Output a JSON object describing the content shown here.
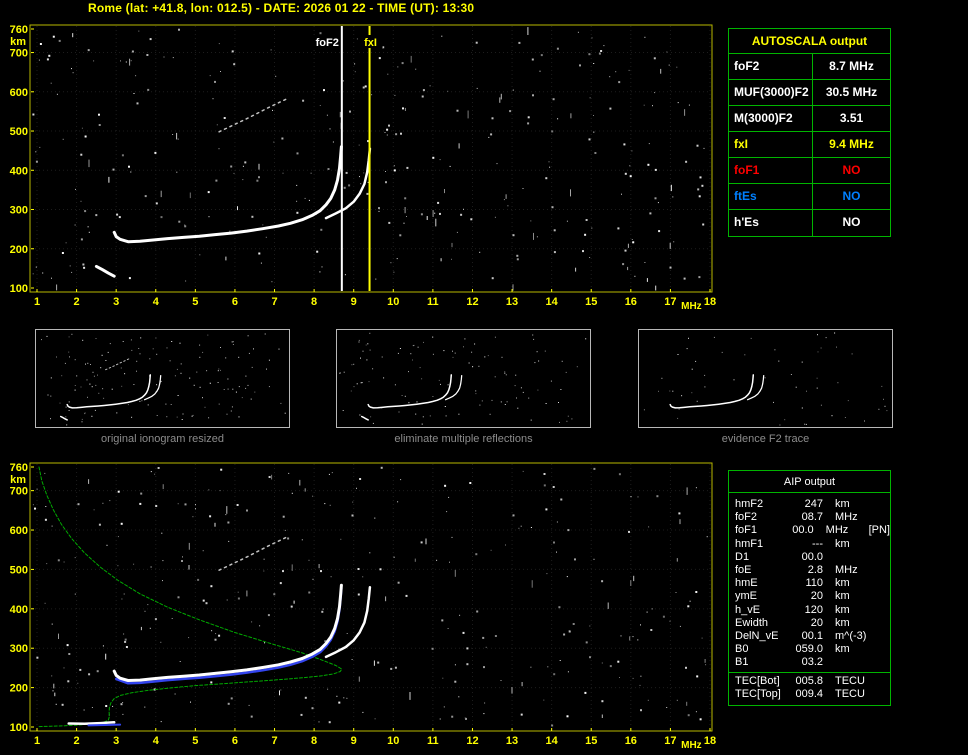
{
  "header": {
    "title": "Rome (lat: +41.8, lon: 012.5) - DATE: 2026 01 22 - TIME (UT): 13:30"
  },
  "autoscala_table": {
    "title": "AUTOSCALA output",
    "rows": [
      {
        "label": "foF2",
        "value": "8.7 MHz",
        "color": "#ffffff"
      },
      {
        "label": "MUF(3000)F2",
        "value": "30.5 MHz",
        "color": "#ffffff"
      },
      {
        "label": "M(3000)F2",
        "value": "3.51",
        "color": "#ffffff"
      },
      {
        "label": "fxI",
        "value": "9.4 MHz",
        "color": "#ffff00"
      },
      {
        "label": "foF1",
        "value": "NO",
        "color": "#ff0000"
      },
      {
        "label": "ftEs",
        "value": "NO",
        "color": "#0080ff"
      },
      {
        "label": "h'Es",
        "value": "NO",
        "color": "#ffffff"
      }
    ]
  },
  "aip_table": {
    "title": "AIP output",
    "rows": [
      {
        "label": "hmF2",
        "value": "247",
        "unit": "km",
        "note": ""
      },
      {
        "label": "foF2",
        "value": "08.7",
        "unit": "MHz",
        "note": ""
      },
      {
        "label": "foF1",
        "value": "00.0",
        "unit": "MHz",
        "note": "[PN]"
      },
      {
        "label": "hmF1",
        "value": "---",
        "unit": "km",
        "note": ""
      },
      {
        "label": "D1",
        "value": "00.0",
        "unit": "",
        "note": ""
      },
      {
        "label": "foE",
        "value": "2.8",
        "unit": "MHz",
        "note": ""
      },
      {
        "label": "hmE",
        "value": "110",
        "unit": "km",
        "note": ""
      },
      {
        "label": "ymE",
        "value": "20",
        "unit": "km",
        "note": ""
      },
      {
        "label": "h_vE",
        "value": "120",
        "unit": "km",
        "note": ""
      },
      {
        "label": "Ewidth",
        "value": "20",
        "unit": "km",
        "note": ""
      },
      {
        "label": "DelN_vE",
        "value": "00.1",
        "unit": "m^(-3)",
        "note": ""
      },
      {
        "label": "B0",
        "value": "059.0",
        "unit": "km",
        "note": ""
      },
      {
        "label": "B1",
        "value": "03.2",
        "unit": "",
        "note": ""
      },
      {
        "label": "TEC[Bot]",
        "value": "005.8",
        "unit": "TECU",
        "note": "",
        "sep": true
      },
      {
        "label": "TEC[Top]",
        "value": "009.4",
        "unit": "TECU",
        "note": ""
      }
    ]
  },
  "thumbnails": [
    {
      "caption": "original ionogram resized",
      "series": [
        "F2-ordinary-trace",
        "F2-extraordinary-trace",
        "spread-echo",
        "E-echo"
      ],
      "noise": {
        "seed": 21,
        "count": 150
      }
    },
    {
      "caption": "eliminate multiple reflections",
      "series": [
        "F2-ordinary-trace",
        "F2-extraordinary-trace",
        "E-echo"
      ],
      "noise": {
        "seed": 22,
        "count": 115
      }
    },
    {
      "caption": "evidence F2 trace",
      "series": [
        "F2-ordinary-trace",
        "F2-extraordinary-trace"
      ],
      "noise": {
        "seed": 23,
        "count": 55
      }
    }
  ],
  "chart_data": [
    {
      "id": "ionogram_top",
      "type": "scatter",
      "title": "ionogram with autoscaled characteristics",
      "xlabel": "MHz",
      "ylabel": "km",
      "xlim": [
        1,
        18
      ],
      "ylim": [
        100,
        760
      ],
      "x_ticks": [
        1,
        2,
        3,
        4,
        5,
        6,
        7,
        8,
        9,
        10,
        11,
        12,
        13,
        14,
        15,
        16,
        17,
        18
      ],
      "y_ticks": [
        100,
        200,
        300,
        400,
        500,
        600,
        700,
        760
      ],
      "grid": false,
      "markers": [
        {
          "label": "foF2",
          "x": 8.7,
          "color": "#ffffff",
          "label_anchor": "end"
        },
        {
          "label": "fxI",
          "x": 9.4,
          "color": "#ffff00",
          "label_anchor": "middle"
        }
      ],
      "series": [
        {
          "name": "F2-ordinary-trace",
          "color": "#ffffff",
          "width": 3,
          "points": [
            [
              2.95,
              242
            ],
            [
              3.0,
              231
            ],
            [
              3.1,
              224
            ],
            [
              3.3,
              218
            ],
            [
              3.6,
              219
            ],
            [
              3.9,
              222
            ],
            [
              4.3,
              226
            ],
            [
              4.7,
              229
            ],
            [
              5.1,
              232
            ],
            [
              5.5,
              236
            ],
            [
              5.9,
              240
            ],
            [
              6.3,
              245
            ],
            [
              6.7,
              251
            ],
            [
              7.1,
              258
            ],
            [
              7.4,
              265
            ],
            [
              7.7,
              274
            ],
            [
              7.95,
              285
            ],
            [
              8.15,
              297
            ],
            [
              8.3,
              312
            ],
            [
              8.42,
              328
            ],
            [
              8.52,
              350
            ],
            [
              8.59,
              375
            ],
            [
              8.64,
              405
            ],
            [
              8.67,
              435
            ],
            [
              8.69,
              460
            ]
          ]
        },
        {
          "name": "F2-extraordinary-trace",
          "color": "#ffffff",
          "width": 2.5,
          "points": [
            [
              8.3,
              278
            ],
            [
              8.55,
              290
            ],
            [
              8.8,
              303
            ],
            [
              9.0,
              320
            ],
            [
              9.15,
              340
            ],
            [
              9.27,
              365
            ],
            [
              9.34,
              395
            ],
            [
              9.38,
              425
            ],
            [
              9.41,
              455
            ]
          ]
        },
        {
          "name": "spread-echo",
          "color": "#c0c0c0",
          "width": 1.5,
          "dash": "2 4",
          "points": [
            [
              5.6,
              498
            ],
            [
              5.85,
              510
            ],
            [
              6.1,
              522
            ],
            [
              6.35,
              534
            ],
            [
              6.6,
              547
            ],
            [
              6.85,
              560
            ],
            [
              7.1,
              572
            ],
            [
              7.35,
              584
            ]
          ]
        },
        {
          "name": "E-echo",
          "color": "#ffffff",
          "width": 3,
          "points": [
            [
              2.5,
              155
            ],
            [
              2.65,
              147
            ],
            [
              2.8,
              138
            ],
            [
              2.95,
              130
            ]
          ]
        }
      ],
      "noise": {
        "seed": 7,
        "count": 340
      }
    },
    {
      "id": "profile_bottom",
      "type": "scatter",
      "title": "ionogram with electron density profile (AIP)",
      "xlabel": "MHz",
      "ylabel": "km",
      "xlim": [
        1,
        18
      ],
      "ylim": [
        100,
        760
      ],
      "x_ticks": [
        1,
        2,
        3,
        4,
        5,
        6,
        7,
        8,
        9,
        10,
        11,
        12,
        13,
        14,
        15,
        16,
        17,
        18
      ],
      "y_ticks": [
        100,
        200,
        300,
        400,
        500,
        600,
        700,
        760
      ],
      "grid": false,
      "markers": [],
      "series": [
        {
          "name": "electron-density-profile",
          "color": "#00aa00",
          "width": 1,
          "dash": "3 2",
          "points": [
            [
              1.05,
              760
            ],
            [
              1.12,
              725
            ],
            [
              1.25,
              688
            ],
            [
              1.42,
              650
            ],
            [
              1.62,
              614
            ],
            [
              1.88,
              578
            ],
            [
              2.2,
              542
            ],
            [
              2.6,
              506
            ],
            [
              3.05,
              472
            ],
            [
              3.6,
              438
            ],
            [
              4.3,
              404
            ],
            [
              5.1,
              372
            ],
            [
              6.0,
              340
            ],
            [
              6.9,
              312
            ],
            [
              7.7,
              288
            ],
            [
              8.25,
              268
            ],
            [
              8.55,
              256
            ],
            [
              8.7,
              247
            ],
            [
              8.66,
              241
            ],
            [
              8.5,
              235
            ],
            [
              8.2,
              230
            ],
            [
              7.7,
              225
            ],
            [
              7.1,
              220
            ],
            [
              6.4,
              215
            ],
            [
              5.7,
              210
            ],
            [
              5.0,
              205
            ],
            [
              4.35,
              199
            ],
            [
              3.8,
              193
            ],
            [
              3.4,
              187
            ],
            [
              3.1,
              180
            ],
            [
              2.95,
              172
            ],
            [
              2.87,
              162
            ],
            [
              2.83,
              150
            ],
            [
              2.82,
              138
            ],
            [
              2.83,
              127
            ],
            [
              2.8,
              117
            ],
            [
              2.65,
              111
            ],
            [
              2.4,
              108
            ],
            [
              2.05,
              105
            ],
            [
              1.7,
              103
            ],
            [
              1.35,
              102
            ],
            [
              1.05,
              101
            ]
          ]
        },
        {
          "name": "fitted-trace",
          "color": "#3344ee",
          "width": 2.5,
          "points": [
            [
              3.0,
              222
            ],
            [
              3.3,
              211
            ],
            [
              3.6,
              212
            ],
            [
              3.9,
              215
            ],
            [
              4.3,
              219
            ],
            [
              4.7,
              222
            ],
            [
              5.1,
              225
            ],
            [
              5.5,
              229
            ],
            [
              5.9,
              233
            ],
            [
              6.3,
              238
            ],
            [
              6.7,
              244
            ],
            [
              7.1,
              251
            ],
            [
              7.4,
              258
            ],
            [
              7.7,
              267
            ],
            [
              7.95,
              278
            ],
            [
              8.15,
              290
            ],
            [
              8.3,
              305
            ],
            [
              8.42,
              321
            ],
            [
              8.52,
              343
            ],
            [
              8.59,
              368
            ],
            [
              8.64,
              398
            ],
            [
              8.67,
              428
            ],
            [
              8.69,
              452
            ]
          ]
        },
        {
          "name": "F2-ordinary-trace",
          "color": "#ffffff",
          "width": 3,
          "points": [
            [
              2.95,
              242
            ],
            [
              3.0,
              231
            ],
            [
              3.1,
              224
            ],
            [
              3.3,
              218
            ],
            [
              3.6,
              219
            ],
            [
              3.9,
              222
            ],
            [
              4.3,
              226
            ],
            [
              4.7,
              229
            ],
            [
              5.1,
              232
            ],
            [
              5.5,
              236
            ],
            [
              5.9,
              240
            ],
            [
              6.3,
              245
            ],
            [
              6.7,
              251
            ],
            [
              7.1,
              258
            ],
            [
              7.4,
              265
            ],
            [
              7.7,
              274
            ],
            [
              7.95,
              285
            ],
            [
              8.15,
              297
            ],
            [
              8.3,
              312
            ],
            [
              8.42,
              328
            ],
            [
              8.52,
              350
            ],
            [
              8.59,
              375
            ],
            [
              8.64,
              405
            ],
            [
              8.67,
              435
            ],
            [
              8.69,
              460
            ]
          ]
        },
        {
          "name": "F2-extraordinary-trace",
          "color": "#ffffff",
          "width": 2.5,
          "points": [
            [
              8.3,
              278
            ],
            [
              8.55,
              290
            ],
            [
              8.8,
              303
            ],
            [
              9.0,
              320
            ],
            [
              9.15,
              340
            ],
            [
              9.27,
              365
            ],
            [
              9.34,
              395
            ],
            [
              9.38,
              425
            ],
            [
              9.41,
              455
            ]
          ]
        },
        {
          "name": "spread-echo",
          "color": "#c0c0c0",
          "width": 1.5,
          "dash": "2 4",
          "points": [
            [
              5.6,
              498
            ],
            [
              5.85,
              510
            ],
            [
              6.1,
              522
            ],
            [
              6.35,
              534
            ],
            [
              6.6,
              547
            ],
            [
              6.85,
              560
            ],
            [
              7.1,
              572
            ],
            [
              7.35,
              584
            ]
          ]
        },
        {
          "name": "E-trace",
          "color": "#ffffff",
          "width": 2.5,
          "points": [
            [
              1.8,
              109
            ],
            [
              2.2,
              108
            ],
            [
              2.6,
              110
            ],
            [
              2.95,
              112
            ]
          ]
        },
        {
          "name": "E-trace-fitted",
          "color": "#3344ee",
          "width": 2,
          "points": [
            [
              2.3,
              104
            ],
            [
              2.7,
              105
            ],
            [
              3.1,
              106
            ]
          ]
        }
      ],
      "noise": {
        "seed": 13,
        "count": 330
      }
    }
  ]
}
